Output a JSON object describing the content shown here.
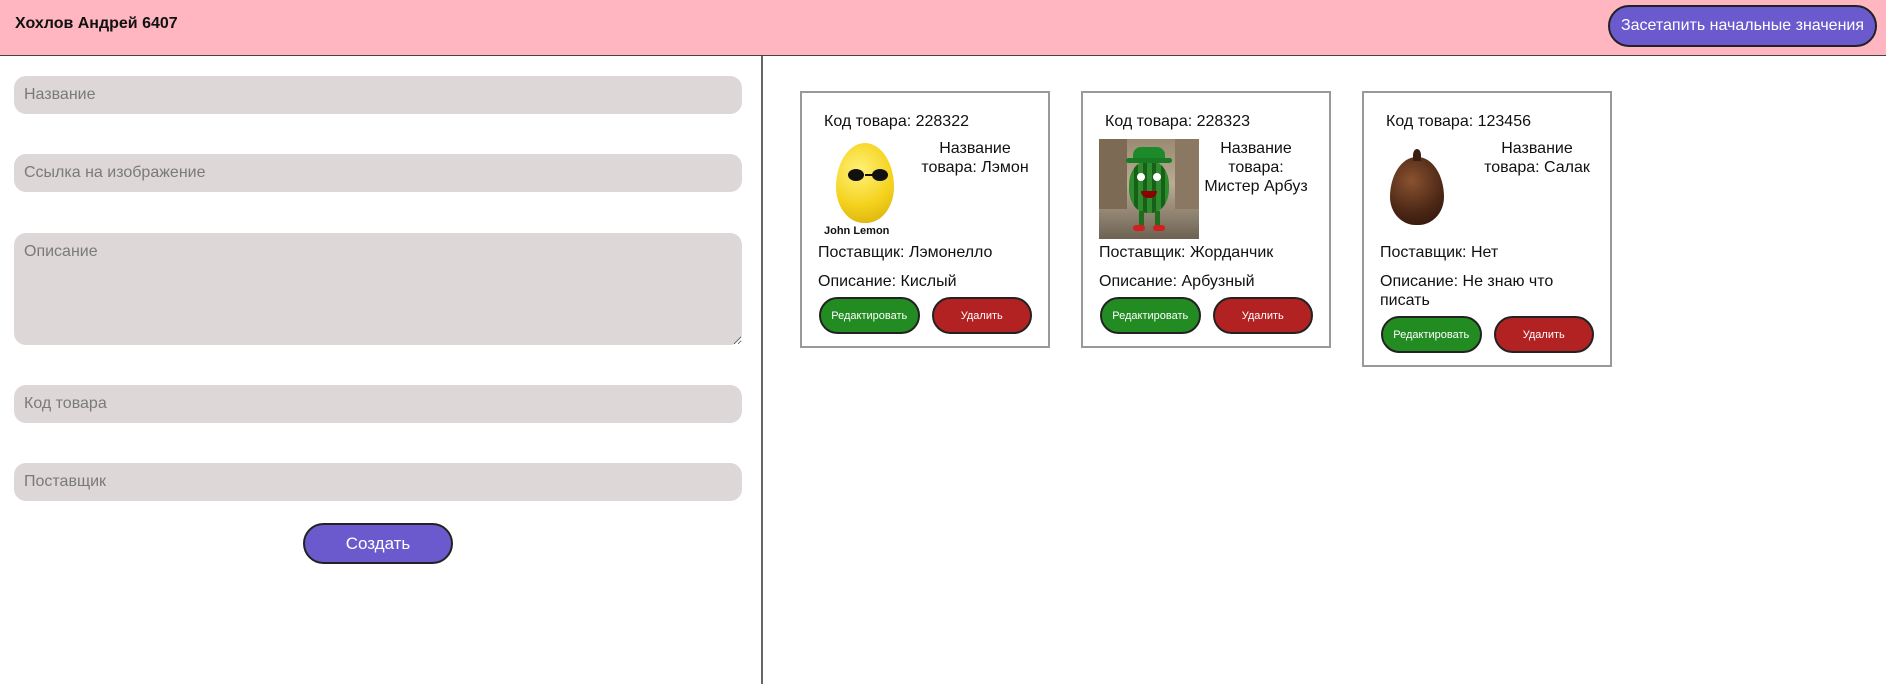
{
  "header": {
    "title": "Хохлов Андрей 6407",
    "reset_button": "Засетапить начальные значения"
  },
  "form": {
    "name_placeholder": "Название",
    "image_placeholder": "Ссылка на изображение",
    "description_placeholder": "Описание",
    "code_placeholder": "Код товара",
    "supplier_placeholder": "Поставщик",
    "create_button": "Создать"
  },
  "products": [
    {
      "code": "Код товара: 228322",
      "name": "Название товара: Лэмон",
      "supplier": "Поставщик: Лэмонелло",
      "description": "Описание: Кислый",
      "image_caption": "John Lemon",
      "image_icon": "lemon-with-sunglasses",
      "edit_label": "Редактировать",
      "delete_label": "Удалить"
    },
    {
      "code": "Код товара: 228323",
      "name": "Название товара: Мистер Арбуз",
      "supplier": "Поставщик: Жорданчик",
      "description": "Описание: Арбузный",
      "image_icon": "watermelon-character",
      "edit_label": "Редактировать",
      "delete_label": "Удалить"
    },
    {
      "code": "Код товара: 123456",
      "name": "Название товара: Салак",
      "supplier": "Поставщик: Нет",
      "description": "Описание: Не знаю что писать",
      "image_icon": "salak-fruit",
      "edit_label": "Редактировать",
      "delete_label": "Удалить"
    }
  ],
  "colors": {
    "header_bg": "#ffb6c1",
    "primary_button": "#6a5acd",
    "edit_button": "#228b22",
    "delete_button": "#b22222",
    "input_bg": "#ddd7d7"
  }
}
